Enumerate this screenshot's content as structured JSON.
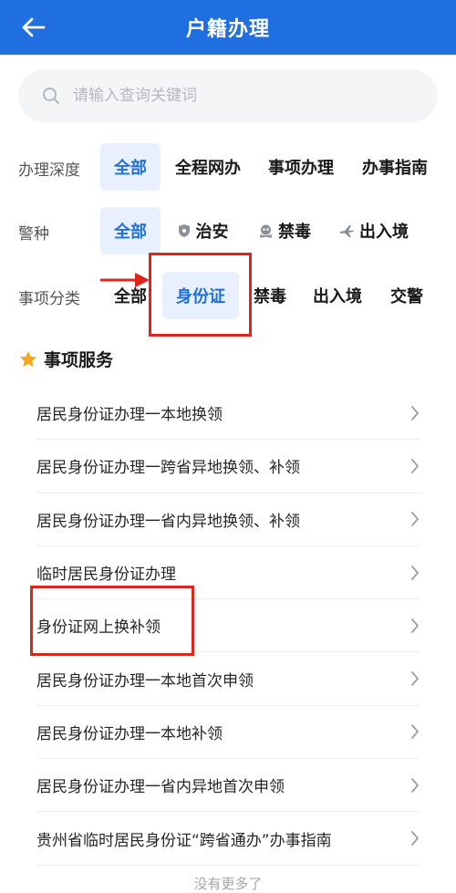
{
  "header": {
    "title": "户籍办理",
    "back_icon": "arrow-left-icon"
  },
  "search": {
    "placeholder": "请输入查询关键词",
    "value": ""
  },
  "filters": {
    "depth": {
      "label": "办理深度",
      "options": [
        "全部",
        "全程网办",
        "事项办理",
        "办事指南"
      ],
      "selected": "全部"
    },
    "police": {
      "label": "警种",
      "options": [
        {
          "label": "全部",
          "icon": ""
        },
        {
          "label": "治安",
          "icon": "shield-icon"
        },
        {
          "label": "禁毒",
          "icon": "skull-icon"
        },
        {
          "label": "出入境",
          "icon": "plane-icon"
        }
      ],
      "selected": "全部"
    },
    "category": {
      "label": "事项分类",
      "options": [
        "全部",
        "身份证",
        "禁毒",
        "出入境",
        "交警"
      ],
      "selected": "身份证"
    }
  },
  "section": {
    "title": "事项服务",
    "icon": "star-icon"
  },
  "items": [
    "居民身份证办理一本地换领",
    "居民身份证办理一跨省异地换领、补领",
    "居民身份证办理一省内异地换领、补领",
    "临时居民身份证办理",
    "身份证网上换补领",
    "居民身份证办理一本地首次申领",
    "居民身份证办理一本地补领",
    "居民身份证办理一省内异地首次申领",
    "贵州省临时居民身份证“跨省通办”办事指南"
  ],
  "footer": "没有更多了",
  "colors": {
    "primary": "#1f6fe0",
    "highlight": "#e0231b",
    "chip_active_bg": "#e8f0fd",
    "star": "#f5a623"
  }
}
